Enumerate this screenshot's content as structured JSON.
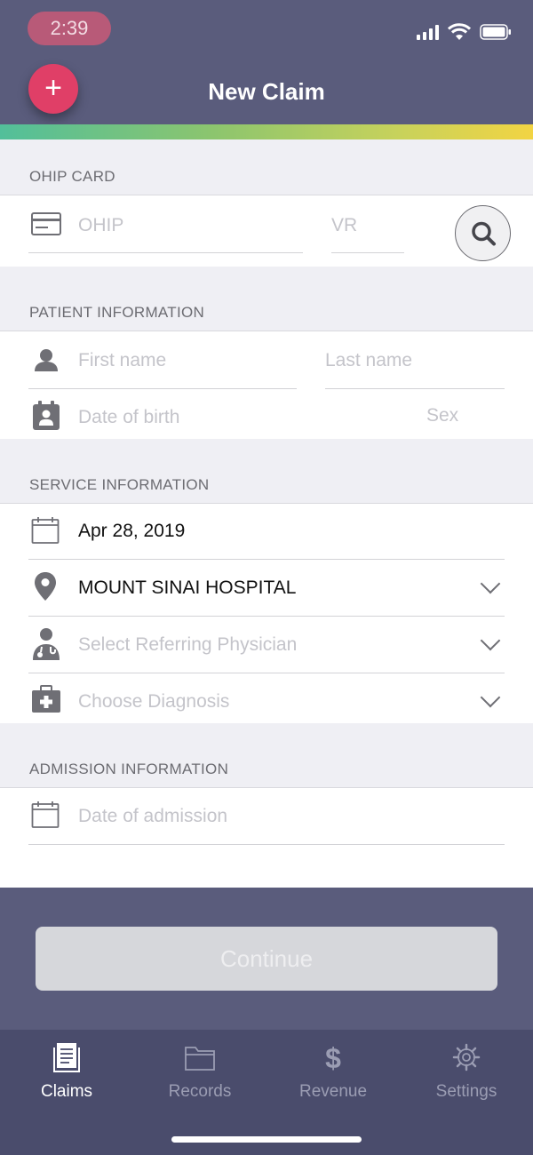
{
  "status_bar": {
    "time": "2:39"
  },
  "header": {
    "title": "New Claim",
    "add_label": "+"
  },
  "ohip_card": {
    "section_title": "OHIP CARD",
    "ohip_placeholder": "OHIP",
    "vr_placeholder": "VR",
    "icons": {
      "card": "credit-card-icon",
      "search": "search-icon"
    }
  },
  "patient_info": {
    "section_title": "PATIENT INFORMATION",
    "first_name_placeholder": "First name",
    "last_name_placeholder": "Last name",
    "dob_placeholder": "Date of birth",
    "sex_placeholder": "Sex"
  },
  "service_info": {
    "section_title": "SERVICE INFORMATION",
    "date": "Apr 28, 2019",
    "location": "MOUNT SINAI HOSPITAL",
    "physician_placeholder": "Select Referring Physician",
    "diagnosis_placeholder": "Choose Diagnosis"
  },
  "admission_info": {
    "section_title": "ADMISSION INFORMATION",
    "admission_placeholder": "Date of admission"
  },
  "continue_label": "Continue",
  "tabs": [
    {
      "label": "Claims",
      "icon": "claims-document-icon",
      "active": true
    },
    {
      "label": "Records",
      "icon": "folder-icon",
      "active": false
    },
    {
      "label": "Revenue",
      "icon": "dollar-icon",
      "active": false
    },
    {
      "label": "Settings",
      "icon": "gear-icon",
      "active": false
    }
  ],
  "colors": {
    "header_bg": "#5a5c7c",
    "accent": "#e03f67",
    "tabbar_bg": "#4a4c6c",
    "section_bg": "#efeff4"
  }
}
